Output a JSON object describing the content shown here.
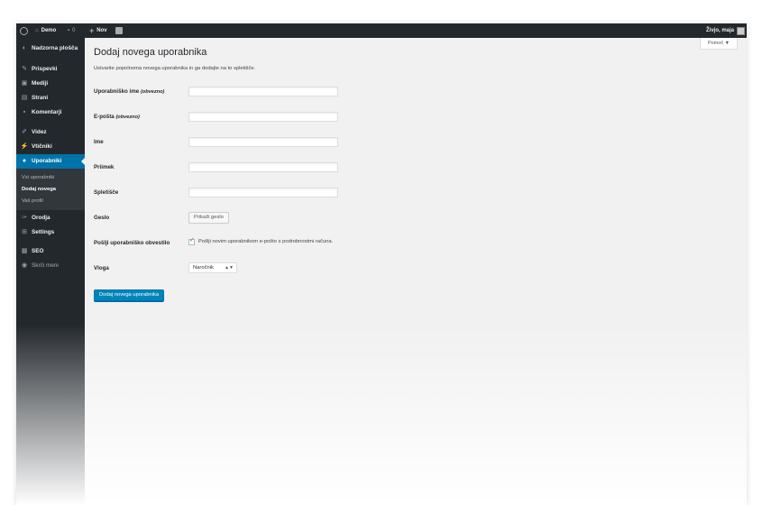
{
  "adminbar": {
    "site_name": "Demo",
    "comments_count": "0",
    "new_label": "Nov",
    "greeting": "Živjo, maja"
  },
  "sidebar": {
    "items": [
      {
        "label": "Nadzorna plošča",
        "icon": "dashboard-icon"
      },
      {
        "label": "Prispevki",
        "icon": "pin-icon"
      },
      {
        "label": "Mediji",
        "icon": "media-icon"
      },
      {
        "label": "Strani",
        "icon": "pages-icon"
      },
      {
        "label": "Komentarji",
        "icon": "comments-icon"
      },
      {
        "label": "Videz",
        "icon": "brush-icon"
      },
      {
        "label": "Vtičniki",
        "icon": "plugin-icon"
      },
      {
        "label": "Uporabniki",
        "icon": "users-icon"
      },
      {
        "label": "Orodja",
        "icon": "tools-icon"
      },
      {
        "label": "Settings",
        "icon": "settings-icon"
      },
      {
        "label": "SEO",
        "icon": "seo-icon"
      },
      {
        "label": "Skrči meni",
        "icon": "collapse-icon"
      }
    ],
    "submenu": [
      "Vsi uporabniki",
      "Dodaj novega",
      "Vaš profil"
    ]
  },
  "help_label": "Pomoč ▼",
  "page": {
    "title": "Dodaj novega uporabnika",
    "description": "Ustvarite popolnoma novega uporabnika in ga dodajte na to spletišče."
  },
  "form": {
    "username_label": "Uporabniško ime",
    "required_note": "(obvezno)",
    "email_label": "E-pošta",
    "firstname_label": "Ime",
    "lastname_label": "Priimek",
    "website_label": "Spletišče",
    "password_label": "Geslo",
    "show_password_button": "Prikaži geslo",
    "notify_label": "Pošlji uporabniško obvestilo",
    "notify_text": "Pošlji novim uporabnikom e-pošto s podrobnostmi računa.",
    "notify_checked": true,
    "role_label": "Vloga",
    "role_value": "Naročnik",
    "submit_label": "Dodaj novega uporabnika"
  },
  "colors": {
    "adminbar": "#23282d",
    "active_menu": "#0073aa",
    "primary_button": "#0085ba"
  }
}
